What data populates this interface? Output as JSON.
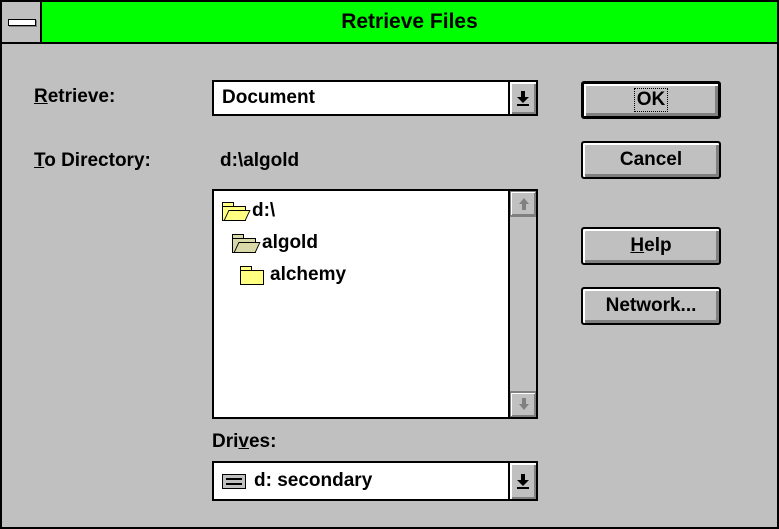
{
  "window": {
    "title": "Retrieve Files",
    "title_color": "#00ff00"
  },
  "retrieve": {
    "label_hotkey": "R",
    "label_rest": "etrieve:",
    "value": "Document"
  },
  "directory": {
    "label_hotkey": "T",
    "label_rest": "o Directory:",
    "path": "d:\\algold"
  },
  "tree": [
    {
      "label": "d:\\",
      "icon": "open-folder-icon"
    },
    {
      "label": "algold",
      "icon": "open-folder-icon"
    },
    {
      "label": "alchemy",
      "icon": "folder-icon"
    }
  ],
  "drives": {
    "label_pre": "Dri",
    "label_hotkey": "v",
    "label_post": "es:",
    "value": "d: secondary"
  },
  "buttons": {
    "ok": "OK",
    "cancel": "Cancel",
    "help_hotkey": "H",
    "help_rest": "elp",
    "network": "Network..."
  }
}
